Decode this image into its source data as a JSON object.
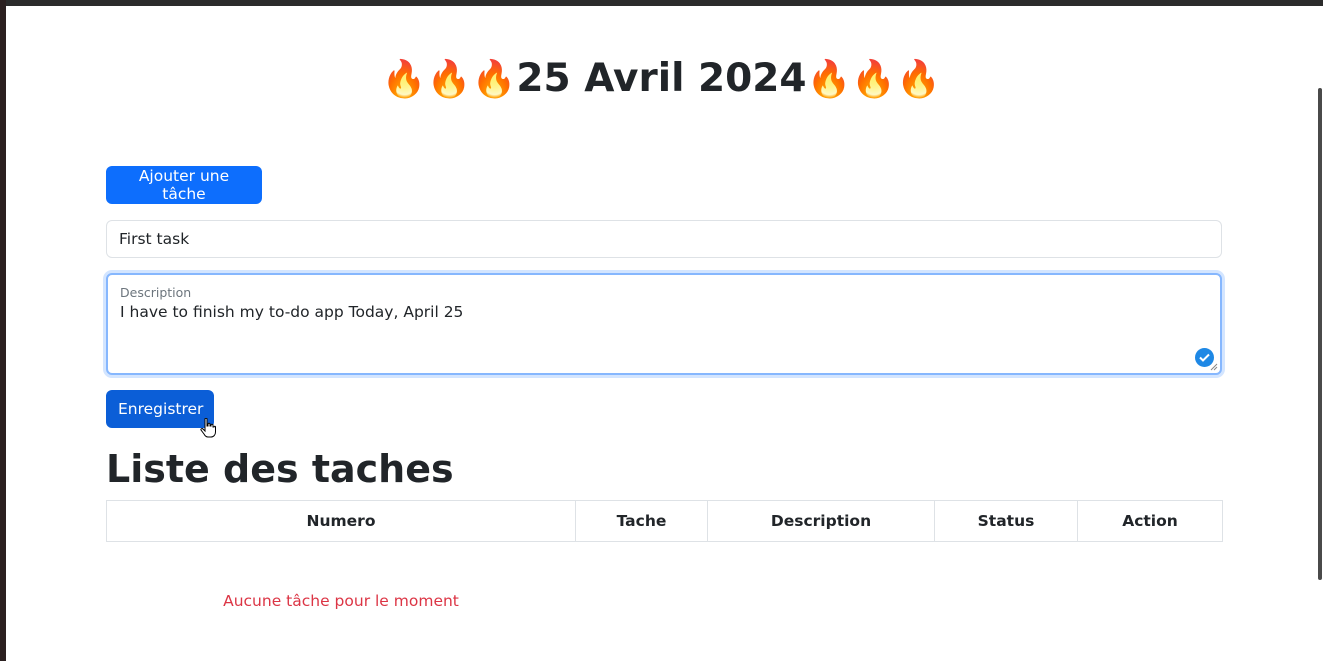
{
  "header": {
    "flames_left": "🔥🔥🔥",
    "date": "25 Avril 2024",
    "flames_right": "🔥🔥🔥"
  },
  "form": {
    "add_button_label": "Ajouter une tâche",
    "task_value": "First task",
    "description_label": "Description",
    "description_value": "I have to finish my to-do app Today, April 25",
    "save_button_label": "Enregistrer"
  },
  "list": {
    "title": "Liste des taches",
    "columns": [
      "Numero",
      "Tache",
      "Description",
      "Status",
      "Action"
    ],
    "empty_message": "Aucune tâche pour le moment"
  },
  "colors": {
    "primary": "#0d6efd",
    "danger": "#dc3545",
    "focus_border": "#86b7fe"
  },
  "icons": [
    "fire-icon",
    "check-circle-icon",
    "resize-handle-icon",
    "pointer-cursor-icon"
  ]
}
